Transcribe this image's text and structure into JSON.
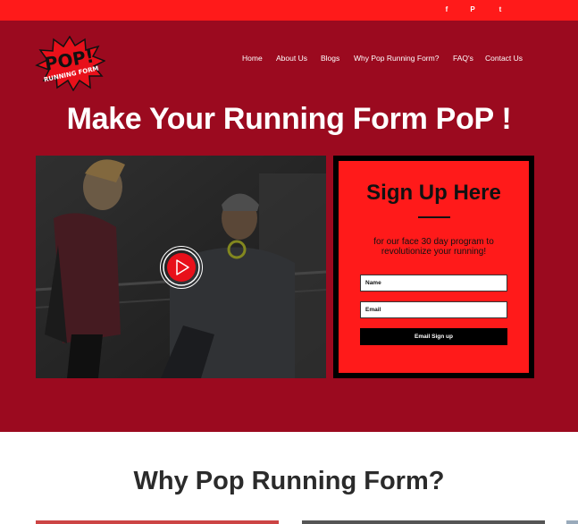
{
  "social": [
    {
      "icon": "facebook-icon",
      "glyph": "f"
    },
    {
      "icon": "pinterest-icon",
      "glyph": "P"
    },
    {
      "icon": "twitter-icon",
      "glyph": "t"
    }
  ],
  "logo": {
    "main": "POP!",
    "sub": "RUNNING FORM"
  },
  "nav": {
    "items": [
      "Home",
      "About Us",
      "Blogs",
      "Why Pop Running Form?",
      "FAQ's",
      "Contact Us"
    ]
  },
  "hero": {
    "headline": "Make Your Running Form PoP !"
  },
  "signup": {
    "title": "Sign Up Here",
    "description": "for our face 30 day program to revolutionize your running!",
    "name_placeholder": "Name",
    "email_placeholder": "Email",
    "button_label": "Email Sign up"
  },
  "section": {
    "title": "Why Pop Running Form?"
  },
  "colors": {
    "topbar": "#ff1a1a",
    "hero_bg": "#9b0a1f",
    "signup_bg": "#ff1a1a",
    "play_button": "#e8101a"
  }
}
